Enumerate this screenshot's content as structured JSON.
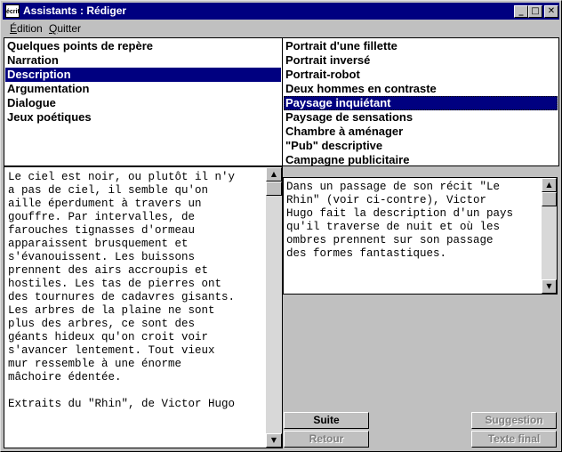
{
  "window": {
    "icon_text": "écrit",
    "title": "Assistants : Rédiger",
    "controls": [
      "_",
      "□",
      "✕"
    ]
  },
  "menubar": {
    "items": [
      {
        "label": "Édition",
        "mnemonic": "É",
        "rest": "dition"
      },
      {
        "label": "Quitter",
        "mnemonic": "Q",
        "rest": "uitter"
      }
    ]
  },
  "left_list": {
    "items": [
      "Quelques points de repère",
      "Narration",
      "Description",
      "Argumentation",
      "Dialogue",
      "Jeux poétiques"
    ],
    "selected": "Description"
  },
  "right_list": {
    "items": [
      "Portrait d'une fillette",
      "Portrait inversé",
      "Portrait-robot",
      "Deux hommes en contraste",
      "Paysage inquiétant",
      "Paysage de sensations",
      "Chambre à aménager",
      "\"Pub\" descriptive",
      "Campagne publicitaire"
    ],
    "selected": "Paysage inquiétant"
  },
  "text_left": "Le ciel est noir, ou plutôt il n'y\na pas de ciel, il semble qu'on\naille éperdument à travers un\ngouffre. Par intervalles, de\nfarouches tignasses d'ormeau\napparaissent brusquement et\ns'évanouissent. Les buissons\nprennent des airs accroupis et\nhostiles. Les tas de pierres ont\ndes tournures de cadavres gisants.\nLes arbres de la plaine ne sont\nplus des arbres, ce sont des\ngéants hideux qu'on croit voir\ns'avancer lentement. Tout vieux\nmur ressemble à une énorme\nmâchoire édentée.\n\nExtraits du \"Rhin\", de Victor Hugo",
  "text_right": "Dans un passage de son récit \"Le\nRhin\" (voir ci-contre), Victor\nHugo fait la description d'un pays\nqu'il traverse de nuit et où les\nombres prennent sur son passage\ndes formes fantastiques.",
  "buttons": {
    "suite": "Suite",
    "retour": "Retour",
    "suggestion": "Suggestion",
    "texte_final": "Texte final"
  },
  "scroll_arrows": {
    "up": "▲",
    "down": "▼"
  }
}
